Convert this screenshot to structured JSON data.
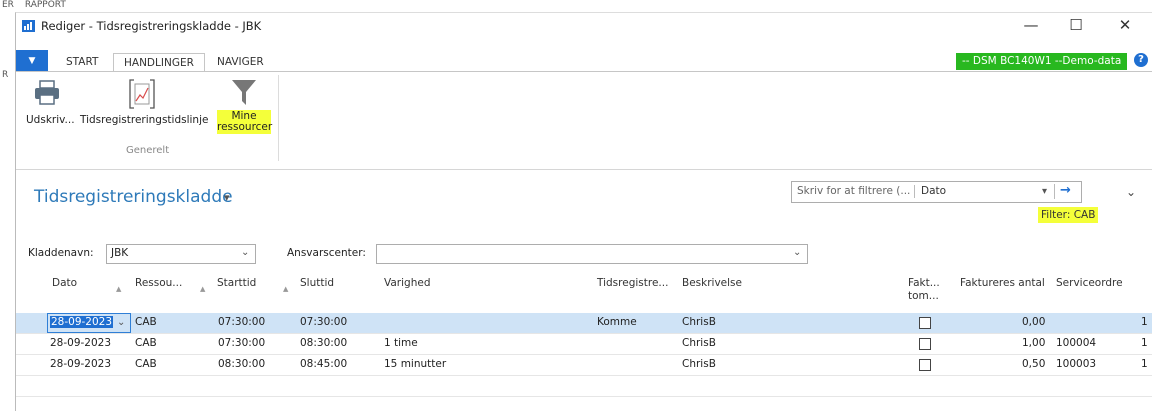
{
  "background": {
    "top_left_fragment": "RAPPORT",
    "side_fragments": [
      "ER",
      "R"
    ]
  },
  "window": {
    "title": "Rediger - Tidsregistreringskladde - JBK",
    "controls": {
      "minimize": "—",
      "maximize": "☐",
      "close": "✕"
    }
  },
  "ribbon": {
    "tabs": [
      "START",
      "HANDLINGER",
      "NAVIGER"
    ],
    "active_tab": "HANDLINGER",
    "env_badge": "-- DSM BC140W1 --Demo-data",
    "help": "?",
    "actions": [
      {
        "label": "Udskriv...",
        "icon": "printer-icon"
      },
      {
        "label": "Tidsregistreringstidslinje",
        "icon": "timeline-chart-icon"
      },
      {
        "label_line1": "Mine",
        "label_line2": "ressourcer",
        "icon": "filter-funnel-icon"
      }
    ],
    "group_label": "Generelt"
  },
  "page": {
    "title": "Tidsregistreringskladde",
    "title_dropdown": "▾",
    "filter": {
      "placeholder": "Skriv for at filtrere (...",
      "field": "Dato",
      "applied": "Filter: CAB"
    }
  },
  "fields": {
    "kladdenavn_label": "Kladdenavn:",
    "kladdenavn_value": "JBK",
    "ansvarscenter_label": "Ansvarscenter:",
    "ansvarscenter_value": ""
  },
  "table": {
    "headers": {
      "dato": "Dato",
      "ressource": "Ressou...",
      "starttid": "Starttid",
      "sluttid": "Sluttid",
      "varighed": "Varighed",
      "tidsregistrering": "Tidsregistre...",
      "beskrivelse": "Beskrivelse",
      "fakt_line1": "Fakt...",
      "fakt_line2": "tom...",
      "faktureres_antal": "Faktureres antal",
      "serviceordre": "Serviceordre"
    },
    "rows": [
      {
        "dato": "28-09-2023",
        "ressource": "CAB",
        "starttid": "07:30:00",
        "sluttid": "07:30:00",
        "varighed": "",
        "tidsregistrering": "Komme",
        "beskrivelse": "ChrisB",
        "fakt": false,
        "antal": "0,00",
        "serviceordre": "",
        "last": "1"
      },
      {
        "dato": "28-09-2023",
        "ressource": "CAB",
        "starttid": "07:30:00",
        "sluttid": "08:30:00",
        "varighed": "1 time",
        "tidsregistrering": "",
        "beskrivelse": "ChrisB",
        "fakt": false,
        "antal": "1,00",
        "serviceordre": "100004",
        "last": "1"
      },
      {
        "dato": "28-09-2023",
        "ressource": "CAB",
        "starttid": "08:30:00",
        "sluttid": "08:45:00",
        "varighed": "15 minutter",
        "tidsregistrering": "",
        "beskrivelse": "ChrisB",
        "fakt": false,
        "antal": "0,50",
        "serviceordre": "100003",
        "last": "1"
      }
    ]
  },
  "colors": {
    "accent": "#1f6fd1",
    "badge": "#28b81f",
    "highlight": "#f4ff3a",
    "title": "#2e7ab9",
    "selected_row": "#cfe3f6"
  }
}
